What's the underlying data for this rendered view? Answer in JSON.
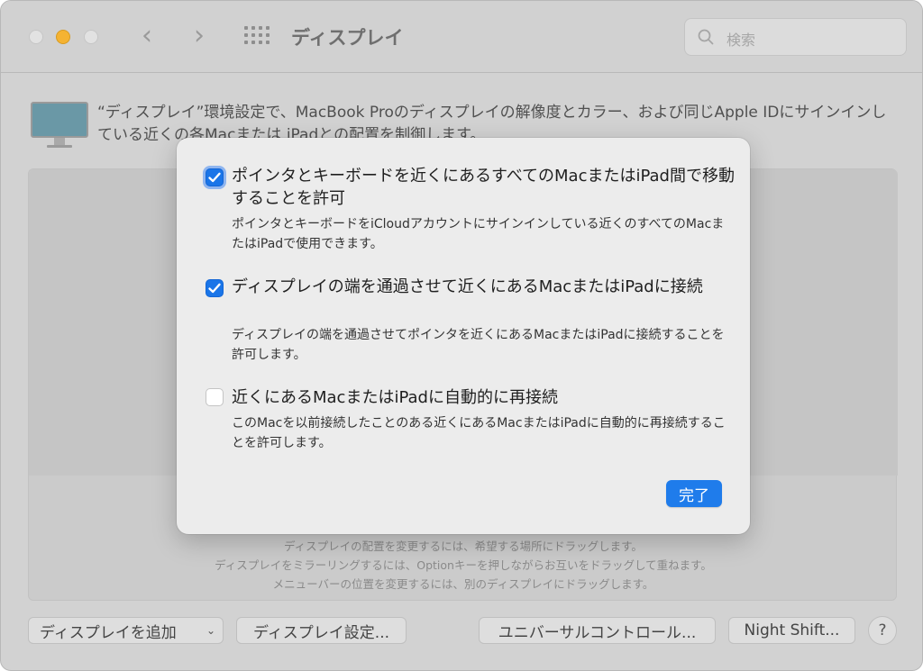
{
  "window": {
    "title": "ディスプレイ",
    "search_placeholder": "検索"
  },
  "description": "“ディスプレイ”環境設定で、MacBook Proのディスプレイの解像度とカラー、および同じApple IDにサインインしている近くの各Macまたは iPadとの配置を制御します。",
  "hints": [
    "ディスプレイの配置を変更するには、希望する場所にドラッグします。",
    "ディスプレイをミラーリングするには、Optionキーを押しながらお互いをドラッグして重ねます。",
    "メニューバーの位置を変更するには、別のディスプレイにドラッグします。"
  ],
  "buttons": {
    "add_display": "ディスプレイを追加",
    "display_settings": "ディスプレイ設定...",
    "universal_control": "ユニバーサルコントロール...",
    "night_shift": "Night Shift...",
    "help": "?"
  },
  "sheet": {
    "options": [
      {
        "checked": true,
        "title": "ポインタとキーボードを近くにあるすべてのMacまたはiPad間で移動することを許可",
        "description": "ポインタとキーボードをiCloudアカウントにサインインしている近くのすべてのMacまたはiPadで使用できます。"
      },
      {
        "checked": true,
        "title": "ディスプレイの端を通過させて近くにあるMacまたはiPadに接続",
        "description": "ディスプレイの端を通過させてポインタを近くにあるMacまたはiPadに接続することを許可します。"
      },
      {
        "checked": false,
        "title": "近くにあるMacまたはiPadに自動的に再接続",
        "description": "このMacを以前接続したことのある近くにあるMacまたはiPadに自動的に再接続することを許可します。"
      }
    ],
    "done_label": "完了"
  },
  "colors": {
    "accent": "#1f7ceb",
    "checkbox_checked": "#1a75e8",
    "minimize_button": "#f5b332"
  },
  "icons": {
    "back": "chevron-left-icon",
    "forward": "chevron-right-icon",
    "all_prefs": "grid-icon",
    "search": "search-icon",
    "display": "monitor-icon",
    "checkbox": "checkmark-icon",
    "popup": "chevron-down-icon"
  }
}
